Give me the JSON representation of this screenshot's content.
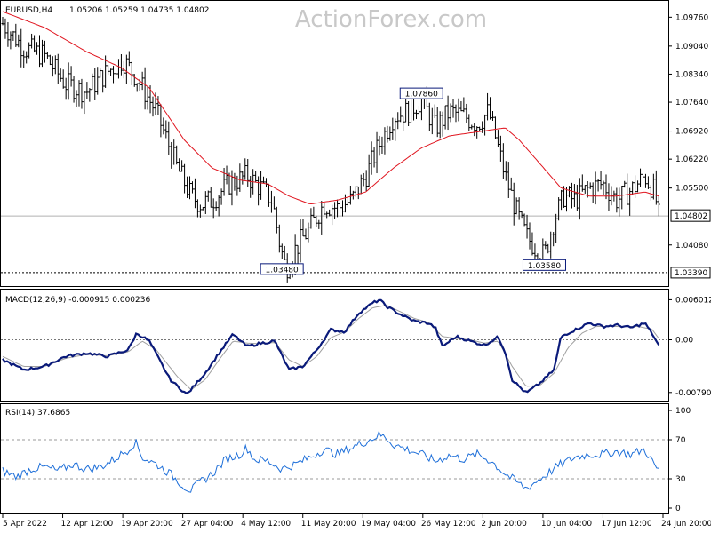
{
  "watermark": "ActionForex.com",
  "header": {
    "symbol": "EURUSD,H4",
    "ohlc": "1.05206 1.05259 1.04735 1.04802"
  },
  "chart_data": [
    {
      "type": "line",
      "panel": "price",
      "subtype": "bar-ohlc",
      "ylim": [
        1.031,
        1.101
      ],
      "yticks": [
        1.0976,
        1.0904,
        1.0834,
        1.0764,
        1.0692,
        1.0622,
        1.055,
        1.0408
      ],
      "ytick_labels": [
        "1.09760",
        "1.09040",
        "1.08340",
        "1.07640",
        "1.06920",
        "1.06220",
        "1.05500",
        "1.04080"
      ],
      "current_price": "1.04802",
      "current_value": 1.04802,
      "support_price": "1.03390",
      "support_value": 1.0339,
      "annotations": [
        {
          "label": "1.07860",
          "value": 1.0786,
          "x": 30.0
        },
        {
          "label": "1.03480",
          "value": 1.0348,
          "x": 20.0
        },
        {
          "label": "1.03580",
          "value": 1.0358,
          "x": 38.8
        }
      ],
      "series": [
        {
          "close_anchors": [
            [
              0,
              1.096
            ],
            [
              1.5,
              1.09
            ],
            [
              3,
              1.088
            ],
            [
              4.5,
              1.081
            ],
            [
              6,
              1.079
            ],
            [
              7.5,
              1.084
            ],
            [
              8.6,
              1.087
            ],
            [
              9.5,
              1.083
            ],
            [
              11,
              1.074
            ],
            [
              12.5,
              1.06
            ],
            [
              13.5,
              1.053
            ],
            [
              14.2,
              1.051
            ],
            [
              15,
              1.052
            ],
            [
              16.2,
              1.056
            ],
            [
              17.5,
              1.058
            ],
            [
              18.5,
              1.055
            ],
            [
              19.3,
              1.052
            ],
            [
              19.9,
              1.04
            ],
            [
              20.3,
              1.035
            ],
            [
              21,
              1.04
            ],
            [
              22,
              1.045
            ],
            [
              23,
              1.051
            ],
            [
              24,
              1.05
            ],
            [
              25,
              1.052
            ],
            [
              26,
              1.058
            ],
            [
              27,
              1.066
            ],
            [
              28,
              1.073
            ],
            [
              29,
              1.074
            ],
            [
              30,
              1.077
            ],
            [
              31,
              1.07
            ],
            [
              32,
              1.074
            ],
            [
              33,
              1.073
            ],
            [
              34,
              1.071
            ],
            [
              34.8,
              1.074
            ],
            [
              35.2,
              1.069
            ],
            [
              36,
              1.058
            ],
            [
              36.8,
              1.049
            ],
            [
              37.5,
              1.043
            ],
            [
              38.2,
              1.04
            ],
            [
              38.8,
              1.038
            ],
            [
              39.5,
              1.047
            ],
            [
              40.2,
              1.053
            ],
            [
              41,
              1.052
            ],
            [
              42,
              1.055
            ],
            [
              43,
              1.056
            ],
            [
              44,
              1.052
            ],
            [
              45.2,
              1.055
            ],
            [
              46,
              1.058
            ],
            [
              46.7,
              1.054
            ],
            [
              47,
              1.048
            ]
          ]
        },
        {
          "name": "",
          "ma_anchors": [
            [
              0,
              1.099
            ],
            [
              3,
              1.095
            ],
            [
              6,
              1.089
            ],
            [
              8.5,
              1.085
            ],
            [
              10.5,
              1.08
            ],
            [
              13,
              1.067
            ],
            [
              15,
              1.06
            ],
            [
              17,
              1.057
            ],
            [
              19,
              1.056
            ],
            [
              20.5,
              1.053
            ],
            [
              22,
              1.051
            ],
            [
              24,
              1.052
            ],
            [
              26,
              1.054
            ],
            [
              28,
              1.06
            ],
            [
              30,
              1.065
            ],
            [
              32,
              1.068
            ],
            [
              34,
              1.069
            ],
            [
              36,
              1.07
            ],
            [
              37,
              1.067
            ],
            [
              38.5,
              1.061
            ],
            [
              40,
              1.055
            ],
            [
              42,
              1.053
            ],
            [
              44,
              1.053
            ],
            [
              46,
              1.054
            ],
            [
              47,
              1.053
            ]
          ]
        }
      ]
    },
    {
      "type": "line",
      "panel": "macd",
      "title": "MACD(12,26,9) -0.000915 0.000236",
      "ylim": [
        -0.009,
        0.007
      ],
      "ytick_labels": [
        "0.006012",
        "0.00",
        "-0.007907"
      ],
      "yticks": [
        0.006012,
        0.0,
        -0.007907
      ],
      "series": [
        {
          "macd_anchors": [
            [
              0,
              -0.003
            ],
            [
              1.5,
              -0.0045
            ],
            [
              3,
              -0.004
            ],
            [
              4.5,
              -0.0025
            ],
            [
              6,
              -0.002
            ],
            [
              7.5,
              -0.0025
            ],
            [
              9,
              -0.0015
            ],
            [
              9.6,
              0.001
            ],
            [
              10.5,
              -0.0002
            ],
            [
              12,
              -0.006
            ],
            [
              13.2,
              -0.0082
            ],
            [
              14.5,
              -0.005
            ],
            [
              15.5,
              -0.002
            ],
            [
              16.5,
              0.0008
            ],
            [
              17.5,
              -0.001
            ],
            [
              18.5,
              -0.0005
            ],
            [
              19.5,
              -0.0002
            ],
            [
              20.5,
              -0.0045
            ],
            [
              21.5,
              -0.004
            ],
            [
              22.5,
              -0.0015
            ],
            [
              23.5,
              0.0015
            ],
            [
              24.5,
              0.0012
            ],
            [
              25.5,
              0.004
            ],
            [
              26.5,
              0.0055
            ],
            [
              27,
              0.006
            ],
            [
              27.5,
              0.005
            ],
            [
              28.5,
              0.0038
            ],
            [
              29.5,
              0.0028
            ],
            [
              30.5,
              0.0025
            ],
            [
              31,
              0.0018
            ],
            [
              31.5,
              -0.001
            ],
            [
              32.5,
              0.0005
            ],
            [
              33.5,
              -0.0002
            ],
            [
              34.5,
              -0.0008
            ],
            [
              35.5,
              0.0004
            ],
            [
              36,
              -0.0018
            ],
            [
              36.5,
              -0.006
            ],
            [
              37.5,
              -0.008
            ],
            [
              38.5,
              -0.0065
            ],
            [
              39.5,
              -0.0045
            ],
            [
              40,
              0.0005
            ],
            [
              41,
              0.0015
            ],
            [
              42,
              0.0025
            ],
            [
              43,
              0.002
            ],
            [
              44,
              0.0022
            ],
            [
              45,
              0.0018
            ],
            [
              46,
              0.0025
            ],
            [
              46.5,
              0.001
            ],
            [
              47,
              -0.0009
            ]
          ]
        },
        {
          "signal_anchors": [
            [
              0,
              -0.0025
            ],
            [
              1.5,
              -0.004
            ],
            [
              3,
              -0.004
            ],
            [
              4.5,
              -0.0028
            ],
            [
              6,
              -0.0022
            ],
            [
              7.5,
              -0.0024
            ],
            [
              9,
              -0.0018
            ],
            [
              10,
              -0.0002
            ],
            [
              11,
              -0.0015
            ],
            [
              12.5,
              -0.0055
            ],
            [
              13.5,
              -0.0075
            ],
            [
              14.5,
              -0.006
            ],
            [
              15.5,
              -0.003
            ],
            [
              16.5,
              -0.0002
            ],
            [
              17.5,
              -0.0005
            ],
            [
              18.5,
              -0.0006
            ],
            [
              19.5,
              -0.0004
            ],
            [
              20.5,
              -0.003
            ],
            [
              21.5,
              -0.004
            ],
            [
              22.5,
              -0.0025
            ],
            [
              23.5,
              0.0003
            ],
            [
              24.5,
              0.0012
            ],
            [
              25.5,
              0.0032
            ],
            [
              26.5,
              0.0048
            ],
            [
              27.5,
              0.0052
            ],
            [
              28.5,
              0.0042
            ],
            [
              29.5,
              0.0032
            ],
            [
              30.5,
              0.0026
            ],
            [
              31.5,
              0.0005
            ],
            [
              32.5,
              0.0002
            ],
            [
              33.5,
              0.0
            ],
            [
              34.5,
              -0.0005
            ],
            [
              35.5,
              -0.0002
            ],
            [
              36.5,
              -0.004
            ],
            [
              37.5,
              -0.007
            ],
            [
              38.5,
              -0.0068
            ],
            [
              39.5,
              -0.005
            ],
            [
              40.5,
              -0.0012
            ],
            [
              41.5,
              0.001
            ],
            [
              42.5,
              0.002
            ],
            [
              43.5,
              0.002
            ],
            [
              44.5,
              0.002
            ],
            [
              45.5,
              0.002
            ],
            [
              46.5,
              0.0016
            ],
            [
              47,
              0.0002
            ]
          ]
        }
      ]
    },
    {
      "type": "line",
      "panel": "rsi",
      "title": "RSI(14) 37.6865",
      "ylim": [
        0,
        100
      ],
      "yticks": [
        100,
        70,
        30,
        0
      ],
      "ytick_labels": [
        "100",
        "70",
        "30",
        "0"
      ],
      "levels": [
        70,
        30
      ],
      "series": [
        {
          "rsi_anchors": [
            [
              0,
              38
            ],
            [
              1,
              32
            ],
            [
              2,
              40
            ],
            [
              3,
              42
            ],
            [
              4,
              38
            ],
            [
              5,
              45
            ],
            [
              6,
              40
            ],
            [
              7,
              42
            ],
            [
              8,
              50
            ],
            [
              9,
              60
            ],
            [
              9.5,
              68
            ],
            [
              10,
              52
            ],
            [
              11,
              45
            ],
            [
              12,
              35
            ],
            [
              13,
              22
            ],
            [
              13.5,
              18
            ],
            [
              14,
              25
            ],
            [
              15,
              35
            ],
            [
              16,
              50
            ],
            [
              17,
              55
            ],
            [
              17.5,
              62
            ],
            [
              18,
              50
            ],
            [
              19,
              48
            ],
            [
              20,
              40
            ],
            [
              21,
              45
            ],
            [
              22,
              52
            ],
            [
              23,
              60
            ],
            [
              24,
              55
            ],
            [
              25,
              62
            ],
            [
              26,
              68
            ],
            [
              27,
              75
            ],
            [
              27.5,
              72
            ],
            [
              28,
              65
            ],
            [
              29,
              60
            ],
            [
              30,
              55
            ],
            [
              31,
              48
            ],
            [
              32,
              54
            ],
            [
              33,
              50
            ],
            [
              34,
              55
            ],
            [
              35,
              48
            ],
            [
              36,
              35
            ],
            [
              37,
              25
            ],
            [
              37.5,
              20
            ],
            [
              38,
              25
            ],
            [
              39,
              35
            ],
            [
              40,
              45
            ],
            [
              41,
              52
            ],
            [
              42,
              55
            ],
            [
              43,
              55
            ],
            [
              44,
              58
            ],
            [
              45,
              55
            ],
            [
              46,
              60
            ],
            [
              46.5,
              48
            ],
            [
              47,
              38
            ]
          ]
        }
      ]
    }
  ],
  "xaxis": {
    "labels": [
      "5 Apr 2022",
      "12 Apr 12:00",
      "19 Apr 20:00",
      "27 Apr 04:00",
      "4 May 12:00",
      "11 May 20:00",
      "19 May 04:00",
      "26 May 12:00",
      "2 Jun 20:00",
      "10 Jun 04:00",
      "17 Jun 12:00",
      "24 Jun 20:00"
    ],
    "positions": [
      0,
      4.3,
      8.6,
      12.9,
      17.2,
      21.5,
      25.8,
      30.1,
      34.4,
      38.7,
      43.0,
      47.3
    ]
  }
}
